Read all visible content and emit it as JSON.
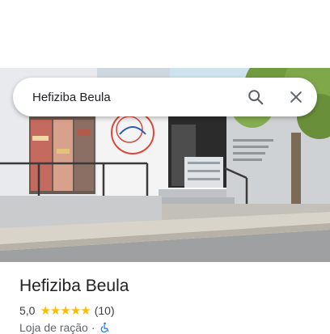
{
  "search": {
    "query": "Hefiziba Beula",
    "search_icon": "search-icon",
    "close_icon": "close-icon"
  },
  "photo": {
    "description_icon": "storefront-photo"
  },
  "place": {
    "name": "Hefiziba Beula",
    "rating": "5,0",
    "stars": 5,
    "review_count": "(10)",
    "category": "Loja de ração",
    "separator": "·",
    "accessibility_icon": "wheelchair-icon"
  },
  "colors": {
    "star": "#fbbc04",
    "accessibility": "#1a73e8",
    "text_primary": "#202124",
    "text_secondary": "#5f6368"
  }
}
